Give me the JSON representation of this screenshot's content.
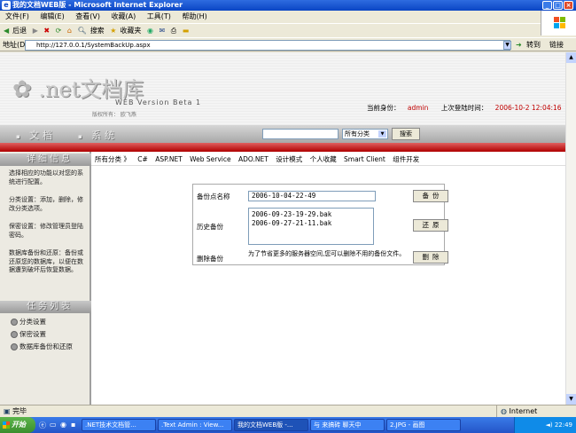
{
  "window": {
    "title": "我的文档WEB版 - Microsoft Internet Explorer"
  },
  "menu": [
    "文件(F)",
    "编辑(E)",
    "查看(V)",
    "收藏(A)",
    "工具(T)",
    "帮助(H)"
  ],
  "toolbar": {
    "back": "后退",
    "search": "搜索",
    "favorites": "收藏夹"
  },
  "address": {
    "label": "地址(D)",
    "url": "http://127.0.0.1/SystemBackUp.aspx",
    "go": "转到",
    "links": "链接"
  },
  "header": {
    "logo": ".net文档库",
    "version": "WEB Version Beta 1",
    "copyright": "版权所有：  欧飞燕",
    "identity_label": "当前身份：",
    "identity_value": "admin",
    "last_login_label": "上次登陆时间：",
    "last_login_value": "2006-10-2 12:04:16"
  },
  "nav": {
    "doc": "文档",
    "system": "系统",
    "search_select": "所有分类",
    "search_button": "搜索"
  },
  "sidebar": {
    "detail_title": "详细信息",
    "paragraphs": [
      "选择相应的功能以对您的系统进行配置。",
      "分类设置：添加，删除，修改分类选项。",
      "保密设置：修改管理员登陆密码。",
      "数据库备份和还原：备份或还原您的数据库，以便在数据遭到破坏后恢复数据。"
    ],
    "task_title": "任务列表",
    "tasks": [
      "分类设置",
      "保密设置",
      "数据库备份和还原"
    ]
  },
  "categories": [
    "所有分类 》",
    "C#",
    "ASP.NET",
    "Web Service",
    "ADO.NET",
    "设计模式",
    "个人收藏",
    "Smart Client",
    "组件开发"
  ],
  "form": {
    "name_label": "备份点名称",
    "name_value": "2006-10-04-22-49",
    "backup_button": "备份",
    "history_label": "历史备份",
    "history": [
      "2006-09-23-19-29.bak",
      "2006-09-27-21-11.bak"
    ],
    "restore_button": "还原",
    "delete_label": "删除备份",
    "delete_note": "为了节省更多的服务器空间,您可以删除不用的备份文件。",
    "delete_button": "删除"
  },
  "status": {
    "text": "完毕",
    "zone": "Internet"
  },
  "taskbar": {
    "start": "开始",
    "tasks": [
      ".NET技术文档管...",
      ".Text Admin : View...",
      "我的文档WEB版 -...",
      "与 来搞砖 聊天中",
      "2.JPG - 画图"
    ],
    "clock": "22:49"
  }
}
